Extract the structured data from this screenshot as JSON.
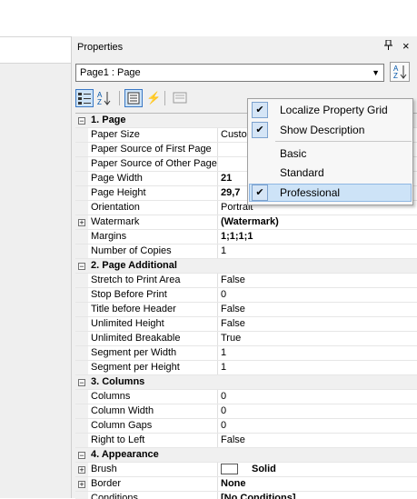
{
  "panel": {
    "title": "Properties",
    "pin_glyph": "═",
    "close_glyph": "×",
    "object_selector": {
      "value": "Page1 : Page"
    },
    "sort_icon_text": "A\nZ"
  },
  "toolbar": {
    "az_text": "A\nZ"
  },
  "grid": {
    "rows": [
      {
        "type": "cat",
        "gut": "−",
        "name": "1. Page"
      },
      {
        "name": "Paper Size",
        "value": "Custom"
      },
      {
        "name": "Paper Source of First Page",
        "value": ""
      },
      {
        "name": "Paper Source of Other Pages",
        "value": ""
      },
      {
        "name": "Page Width",
        "value": "21",
        "bold": true
      },
      {
        "name": "Page Height",
        "value": "29,7",
        "bold": true
      },
      {
        "name": "Orientation",
        "value": "Portrait"
      },
      {
        "gut": "+",
        "name": "Watermark",
        "value": "(Watermark)",
        "bold": true
      },
      {
        "name": "Margins",
        "value": "1;1;1;1",
        "bold": true
      },
      {
        "name": "Number of Copies",
        "value": "1"
      },
      {
        "type": "cat",
        "gut": "−",
        "name": "2. Page  Additional"
      },
      {
        "name": "Stretch to Print Area",
        "value": "False"
      },
      {
        "name": "Stop Before Print",
        "value": "0"
      },
      {
        "name": "Title before Header",
        "value": "False"
      },
      {
        "name": "Unlimited Height",
        "value": "False"
      },
      {
        "name": "Unlimited Breakable",
        "value": "True"
      },
      {
        "name": "Segment per Width",
        "value": "1"
      },
      {
        "name": "Segment per Height",
        "value": "1"
      },
      {
        "type": "cat",
        "gut": "−",
        "name": "3. Columns"
      },
      {
        "name": "Columns",
        "value": "0"
      },
      {
        "name": "Column Width",
        "value": "0"
      },
      {
        "name": "Column Gaps",
        "value": "0"
      },
      {
        "name": "Right to Left",
        "value": "False"
      },
      {
        "type": "cat",
        "gut": "−",
        "name": "4. Appearance"
      },
      {
        "gut": "+",
        "name": "Brush",
        "value": "Solid",
        "bold": true,
        "swatch": true
      },
      {
        "gut": "+",
        "name": "Border",
        "value": "None",
        "bold": true
      },
      {
        "name": "Conditions",
        "value": "[No Conditions]",
        "bold": true
      }
    ]
  },
  "menu": {
    "items": [
      {
        "label": "Localize Property Grid",
        "checked": true
      },
      {
        "label": "Show Description",
        "checked": true
      },
      {
        "label": "Basic",
        "checked": false
      },
      {
        "label": "Standard",
        "checked": false
      },
      {
        "label": "Professional",
        "checked": true,
        "highlighted": true
      }
    ],
    "check_glyph": "✔"
  },
  "colors": {
    "accent": "#3a78c5",
    "highlight": "#cde3f7"
  }
}
